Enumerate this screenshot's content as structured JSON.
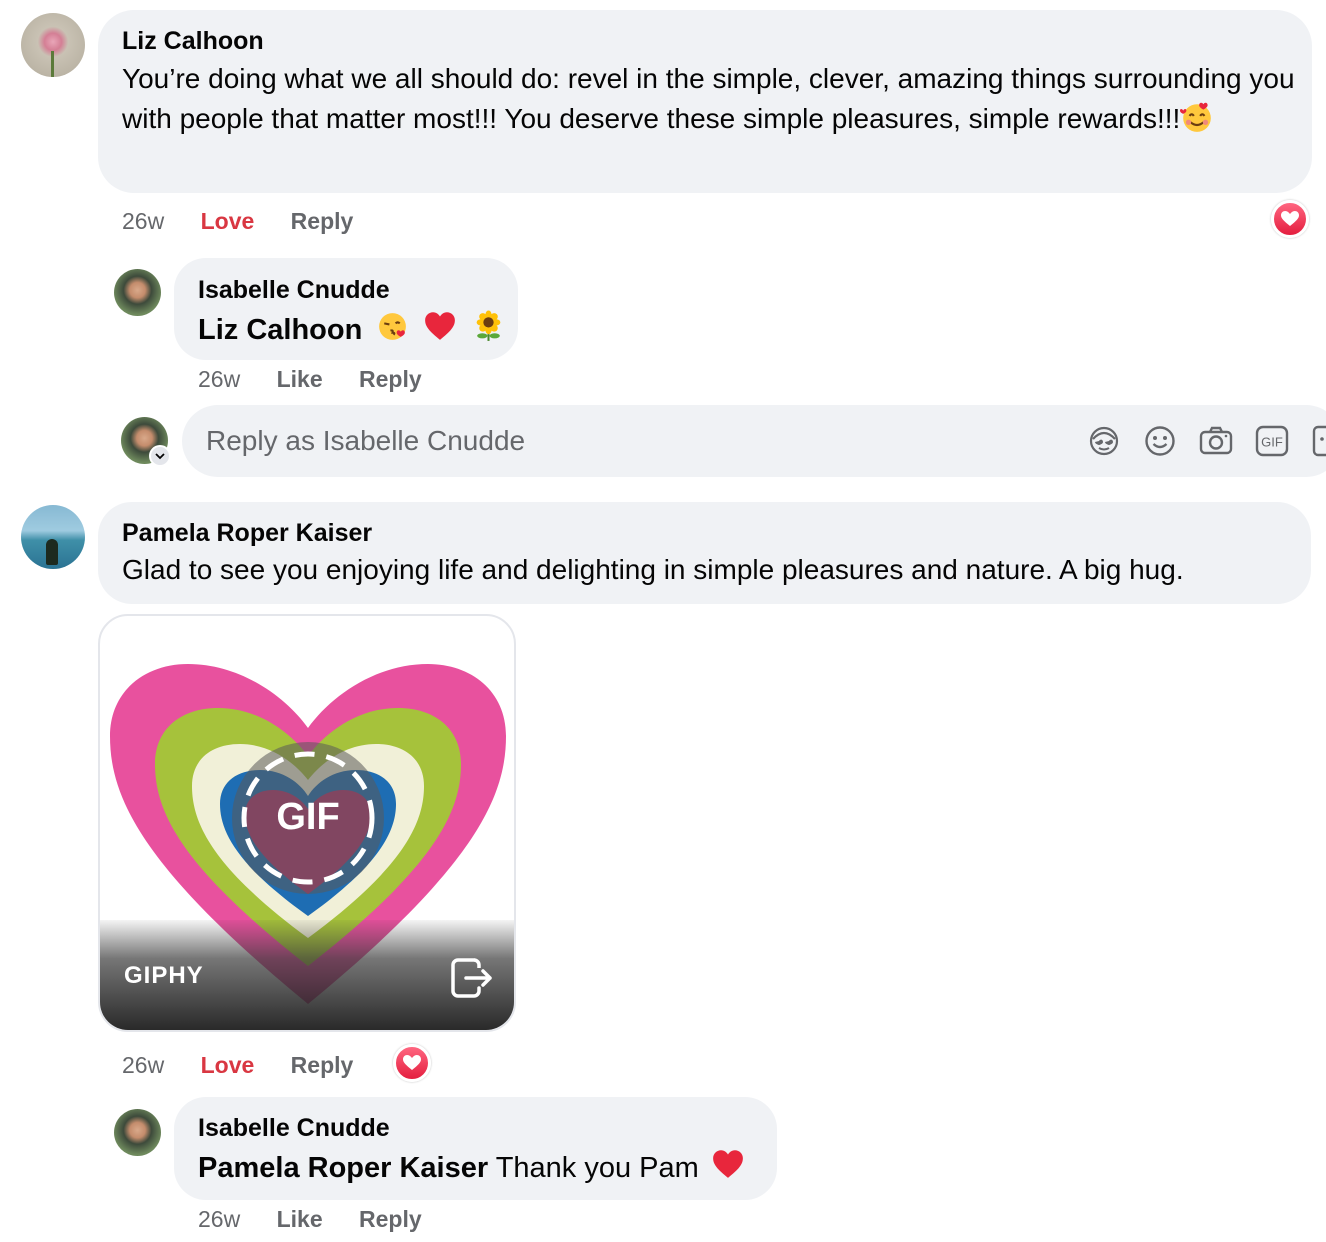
{
  "comments": [
    {
      "author": "Liz Calhoon",
      "text": "You’re doing what we all should do: revel in the simple, clever, amazing things surrounding you with people that matter most!!! You deserve these simple pleasures, simple rewards!!!",
      "emoji": "smiling-face-with-hearts",
      "time": "26w",
      "reaction_label": "Love",
      "reply_label": "Reply",
      "reaction_badge": "heart",
      "replies": [
        {
          "author": "Isabelle Cnudde",
          "mention": "Liz Calhoon",
          "emojis": [
            "kissing-face",
            "red-heart",
            "sunflower"
          ],
          "time": "26w",
          "like_label": "Like",
          "reply_label": "Reply"
        }
      ],
      "reply_box": {
        "placeholder": "Reply as Isabelle Cnudde",
        "icons": [
          "avatar-sticker-icon",
          "emoji-icon",
          "camera-icon",
          "gif-icon",
          "sticker-icon"
        ]
      }
    },
    {
      "author": "Pamela Roper Kaiser",
      "text": "Glad to see you enjoying life and delighting in simple pleasures and nature. A big hug.",
      "attachment": {
        "type": "gif",
        "badge": "GIF",
        "provider": "GIPHY"
      },
      "time": "26w",
      "reaction_label": "Love",
      "reply_label": "Reply",
      "reaction_badge": "heart",
      "replies": [
        {
          "author": "Isabelle Cnudde",
          "mention": "Pamela Roper Kaiser",
          "text": "Thank you Pam",
          "emojis": [
            "red-heart"
          ],
          "time": "26w",
          "like_label": "Like",
          "reply_label": "Reply"
        }
      ]
    }
  ],
  "colors": {
    "bubble": "#f0f2f5",
    "meta_text": "#65676b",
    "love_red": "#d93742",
    "heart_pink": "#e74fa0",
    "heart_green": "#a5c23a"
  }
}
